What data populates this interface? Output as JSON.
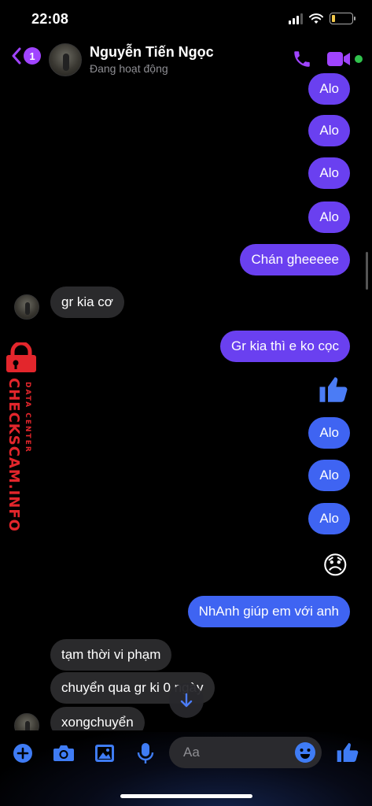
{
  "status_bar": {
    "time": "22:08",
    "battery_level": 0.18
  },
  "header": {
    "unread_count": "1",
    "contact_name": "Nguyễn Tiến Ngọc",
    "contact_status": "Đang hoạt động",
    "accent_color": "#a044ff",
    "online_color": "#31c24d"
  },
  "messages": [
    {
      "direction": "out",
      "text": "Alo"
    },
    {
      "direction": "out",
      "text": "Alo"
    },
    {
      "direction": "out",
      "text": "Alo"
    },
    {
      "direction": "out",
      "text": "Alo"
    },
    {
      "direction": "out",
      "text": "Chán gheeeee"
    },
    {
      "direction": "in",
      "text": "gr kia cơ"
    },
    {
      "direction": "out",
      "text": "Gr kia thì e ko cọc"
    },
    {
      "direction": "out",
      "type": "like",
      "icon": "thumbs-up-icon"
    },
    {
      "direction": "out",
      "text": "Alo"
    },
    {
      "direction": "out",
      "text": "Alo"
    },
    {
      "direction": "out",
      "text": "Alo"
    },
    {
      "direction": "out",
      "type": "emoji",
      "text": "😞"
    },
    {
      "direction": "out",
      "text": "NhAnh giúp em với anh"
    },
    {
      "direction": "in",
      "text": "tạm thời vi phạm"
    },
    {
      "direction": "in",
      "text": "chuyển qua gr ki  0 ngày"
    },
    {
      "direction": "in",
      "text": "xongchuyển"
    }
  ],
  "watermark": {
    "main": "CHECKSCAM.INFO",
    "sub": "DATA CENTER",
    "color": "#e3262c"
  },
  "composer": {
    "placeholder": "Aa",
    "icons": [
      "add-icon",
      "camera-icon",
      "gallery-icon",
      "microphone-icon",
      "emoji-icon",
      "thumbs-up-icon"
    ],
    "accent_color": "#3f7cf5"
  },
  "colors": {
    "outgoing_bubble": "#6a40f0",
    "outgoing_bubble_blue": "#3f64f2",
    "incoming_bubble": "#2a2a2c"
  }
}
